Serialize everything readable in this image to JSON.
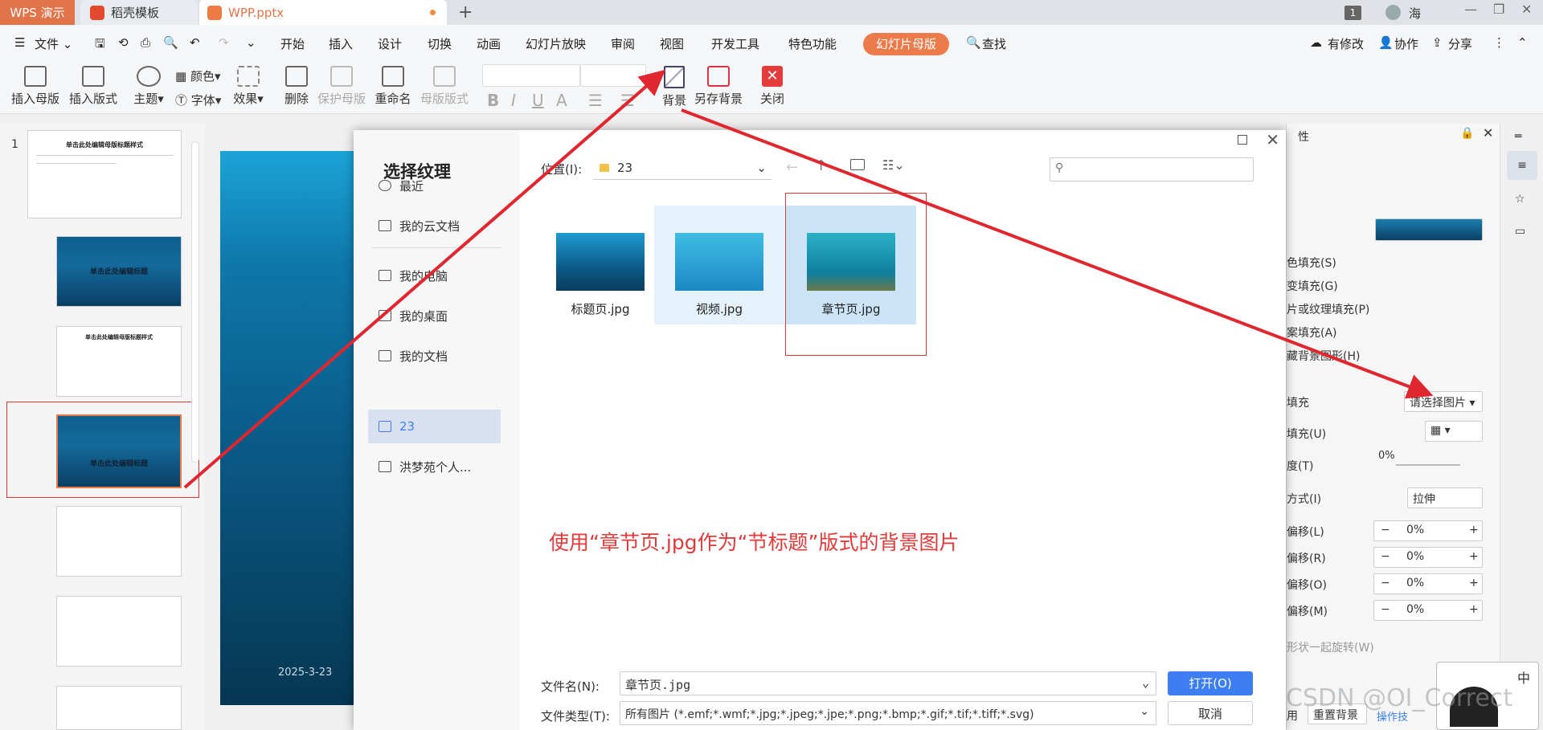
{
  "titlebar": {
    "wps_tab": "WPS 演示",
    "template_tab": "稻壳模板",
    "file_tab": "WPP.pptx",
    "badge": "1",
    "user": "海"
  },
  "menubar": {
    "file": "文件",
    "items": [
      "开始",
      "插入",
      "设计",
      "切换",
      "动画",
      "幻灯片放映",
      "审阅",
      "视图",
      "开发工具",
      "特色功能"
    ],
    "active": "幻灯片母版",
    "search": "查找",
    "modified": "有修改",
    "collab": "协作",
    "share": "分享"
  },
  "ribbon": {
    "insert_master": "插入母版",
    "insert_layout": "插入版式",
    "theme": "主题",
    "color": "颜色",
    "font": "字体",
    "effect": "效果",
    "delete": "删除",
    "protect_master": "保护母版",
    "rename": "重命名",
    "master_layout": "母版版式",
    "background": "背景",
    "save_background": "另存背景",
    "close": "关闭"
  },
  "slides": {
    "number": "1",
    "master_title": "单击此处编辑母版标题样式",
    "title_layout": "单击此处编辑标题",
    "section_layout": "单击此处编辑标题",
    "content_title": "单击此处编辑母版标题样式",
    "date": "2025-3-23"
  },
  "dialog": {
    "title": "选择纹理",
    "nav": [
      "最近",
      "我的云文档",
      "我的电脑",
      "我的桌面",
      "我的文档",
      "23",
      "洪梦苑个人..."
    ],
    "location_label": "位置(I):",
    "location_value": "23",
    "files": [
      "标题页.jpg",
      "视频.jpg",
      "章节页.jpg"
    ],
    "annotation": "使用“章节页.jpg作为“节标题”版式的背景图片",
    "filename_label": "文件名(N):",
    "filename_value": "章节页.jpg",
    "filetype_label": "文件类型(T):",
    "filetype_value": "所有图片 (*.emf;*.wmf;*.jpg;*.jpeg;*.jpe;*.png;*.bmp;*.gif;*.tif;*.tiff;*.svg)",
    "open": "打开(O)",
    "cancel": "取消"
  },
  "rightpanel": {
    "header": "性",
    "solid": "色填充(S)",
    "gradient": "变填充(G)",
    "picture": "片或纹理填充(P)",
    "pattern": "案填充(A)",
    "hide": "藏背景图形(H)",
    "fill_label": "填充",
    "fill_value": "请选择图片",
    "fill2_label": "填充(U)",
    "transparency_label": "度(T)",
    "transparency_value": "0%",
    "mode_label": "方式(I)",
    "mode_value": "拉伸",
    "offset_left": "偏移(L)",
    "offset_right": "偏移(R)",
    "offset_top": "偏移(O)",
    "offset_bottom": "偏移(M)",
    "offset_values": [
      "0%",
      "0%",
      "0%",
      "0%"
    ],
    "rotate": "形状一起旋转(W)",
    "apply": "用",
    "reset": "重置背景",
    "tips": "操作技",
    "ime": "中"
  },
  "watermark": "CSDN @OI_Correct"
}
